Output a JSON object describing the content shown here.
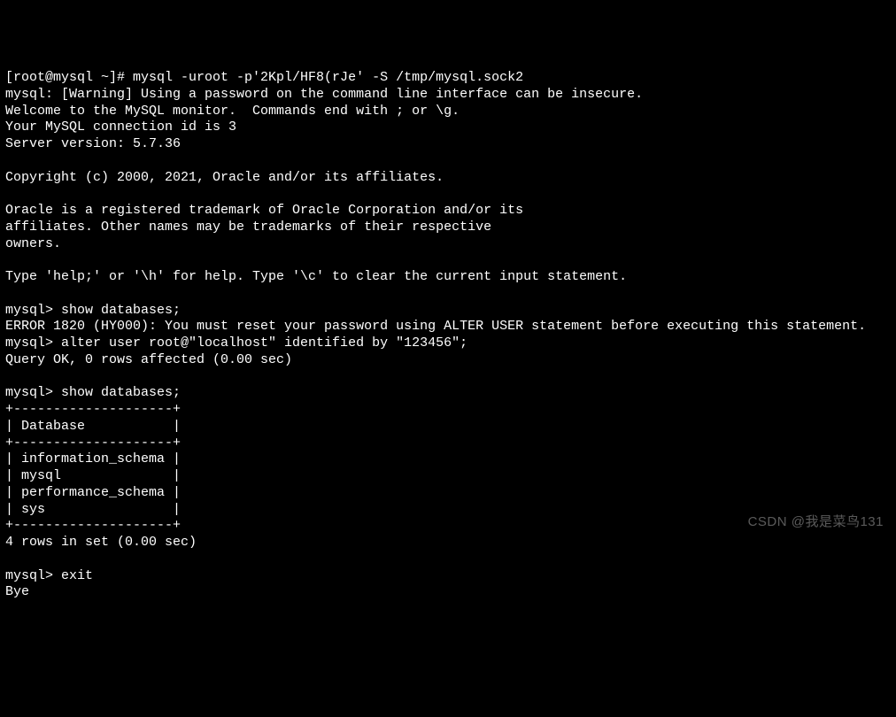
{
  "lines": {
    "l0": "[root@mysql ~]# mysql -uroot -p'2Kpl/HF8(rJe' -S /tmp/mysql.sock2",
    "l1": "mysql: [Warning] Using a password on the command line interface can be insecure.",
    "l2": "Welcome to the MySQL monitor.  Commands end with ; or \\g.",
    "l3": "Your MySQL connection id is 3",
    "l4": "Server version: 5.7.36",
    "l5": "",
    "l6": "Copyright (c) 2000, 2021, Oracle and/or its affiliates.",
    "l7": "",
    "l8": "Oracle is a registered trademark of Oracle Corporation and/or its",
    "l9": "affiliates. Other names may be trademarks of their respective",
    "l10": "owners.",
    "l11": "",
    "l12": "Type 'help;' or '\\h' for help. Type '\\c' to clear the current input statement.",
    "l13": "",
    "l14": "mysql> show databases;",
    "l15": "ERROR 1820 (HY000): You must reset your password using ALTER USER statement before executing this statement.",
    "l16": "mysql> alter user root@\"localhost\" identified by \"123456\";",
    "l17": "Query OK, 0 rows affected (0.00 sec)",
    "l18": "",
    "l19": "mysql> show databases;",
    "l20": "+--------------------+",
    "l21": "| Database           |",
    "l22": "+--------------------+",
    "l23": "| information_schema |",
    "l24": "| mysql              |",
    "l25": "| performance_schema |",
    "l26": "| sys                |",
    "l27": "+--------------------+",
    "l28": "4 rows in set (0.00 sec)",
    "l29": "",
    "l30": "mysql> exit",
    "l31": "Bye"
  },
  "watermark": "CSDN @我是菜鸟131"
}
